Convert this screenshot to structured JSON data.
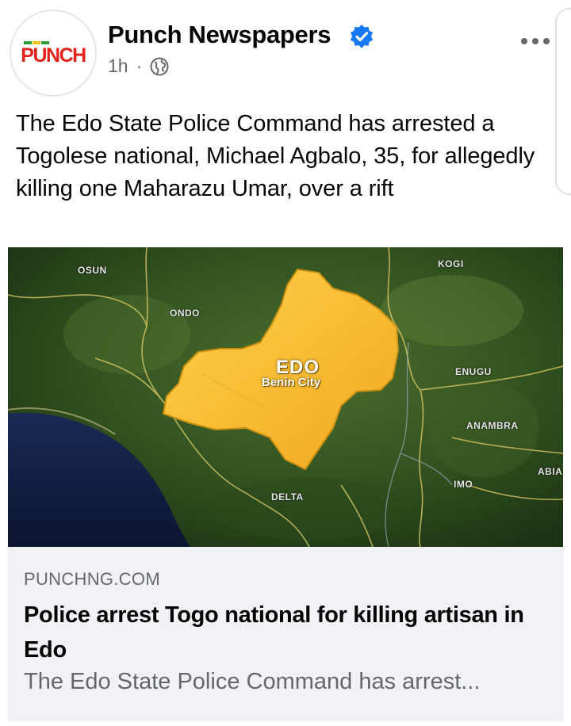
{
  "post": {
    "page_name": "Punch Newspapers",
    "logo_text": "PUNCH",
    "time": "1h",
    "separator": "·",
    "caption": "The Edo State Police Command has arrested a Togolese national, Michael Agbalo, 35, for allegedly killing one Maharazu Umar, over a rift"
  },
  "icons": {
    "verified": "verified-badge-icon",
    "audience": "globe-icon",
    "menu": "more-options-icon"
  },
  "map": {
    "main_state": "EDO",
    "capital": "Benin City",
    "neighbors": [
      "OSUN",
      "ONDO",
      "KOGI",
      "ENUGU",
      "ANAMBRA",
      "ABIA",
      "IMO",
      "DELTA"
    ]
  },
  "link": {
    "domain": "PUNCHNG.COM",
    "headline": "Police arrest Togo national for killing artisan in Edo",
    "description": "The Edo State Police Command has arrest..."
  },
  "colors": {
    "verified_blue": "#1877f2",
    "logo_red": "#e2231a",
    "edo_yellow": "#f5b82a",
    "preview_bg": "#f0f2f5"
  }
}
